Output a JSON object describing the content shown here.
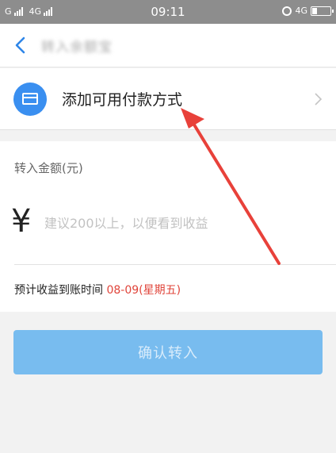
{
  "status_bar": {
    "sim1": "G",
    "sim2": "4G",
    "time": "09:11",
    "net_right": "4G"
  },
  "header": {
    "title": "转入余额宝"
  },
  "payment": {
    "label": "添加可用付款方式",
    "accent": "#3a8ff0"
  },
  "amount": {
    "label": "转入金额(元)",
    "currency": "¥",
    "placeholder": "建议200以上，以便看到收益"
  },
  "estimate": {
    "label": "预计收益到账时间 ",
    "date": "08-09(星期五)"
  },
  "confirm": {
    "label": "确认转入",
    "color": "#78bcef"
  },
  "annotation": {
    "color": "#e8413a"
  }
}
